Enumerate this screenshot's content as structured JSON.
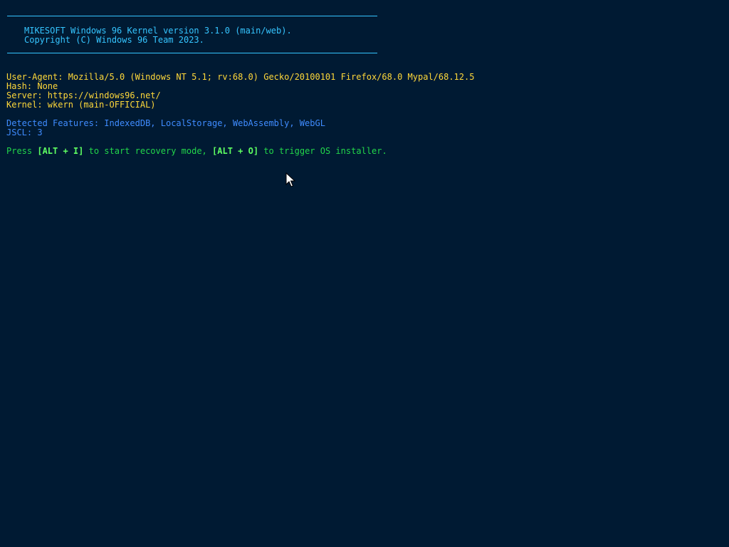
{
  "banner": {
    "line1": "MIKESOFT Windows 96 Kernel version 3.1.0 (main/web).",
    "line2": "Copyright (C) Windows 96 Team 2023."
  },
  "info": {
    "user_agent": "User-Agent: Mozilla/5.0 (Windows NT 5.1; rv:68.0) Gecko/20100101 Firefox/68.0 Mypal/68.12.5",
    "hash": "Hash: None",
    "server": "Server: https://windows96.net/",
    "kernel": "Kernel: wkern (main-OFFICIAL)"
  },
  "features": {
    "detected": "Detected Features: IndexedDB, LocalStorage, WebAssembly, WebGL",
    "jscl": "JSCL: 3"
  },
  "prompt": {
    "press": "Press ",
    "key_recovery": "[ALT + I]",
    "recovery_text": " to start recovery mode, ",
    "key_installer": "[ALT + O]",
    "installer_text": " to trigger OS installer."
  },
  "colors": {
    "background": "#001a33",
    "banner": "#35c5ff",
    "info": "#ffd83a",
    "features": "#3f8cff",
    "prompt": "#22d64a",
    "key_highlight": "#5eff62"
  },
  "icons": {
    "pointer": "mouse-pointer-icon"
  }
}
